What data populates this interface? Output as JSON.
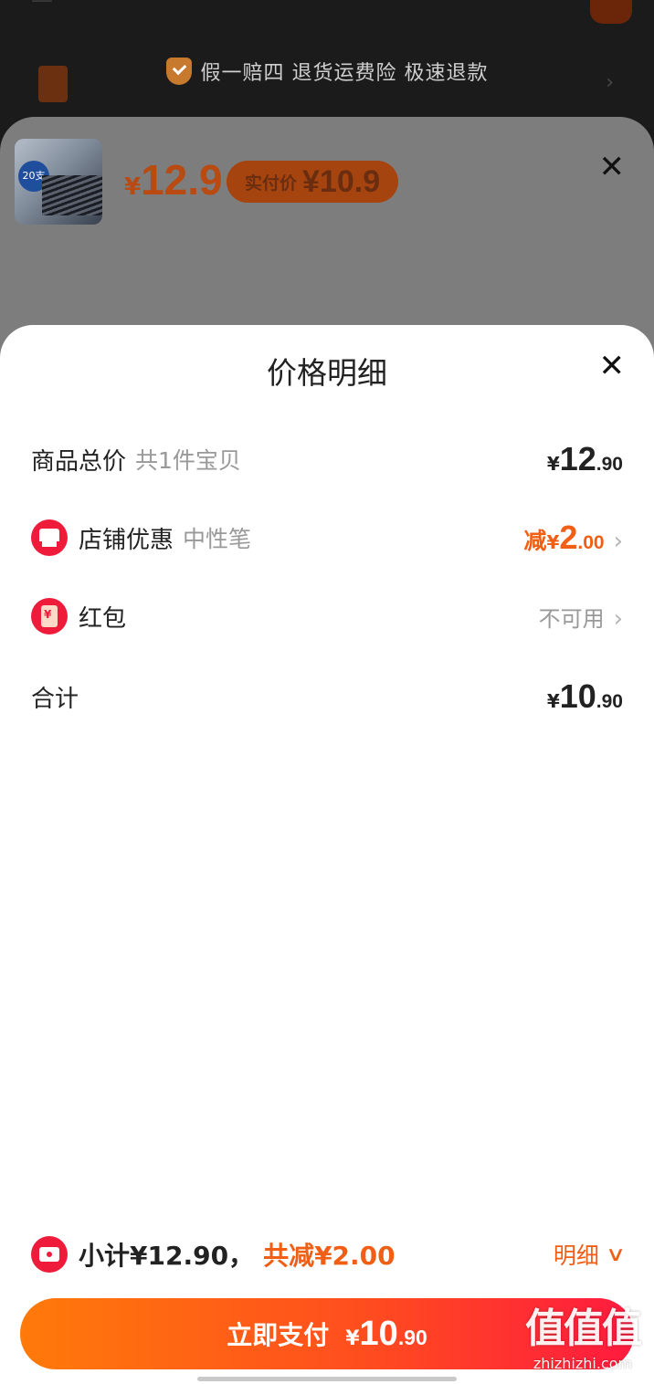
{
  "background": {
    "guarantee_text": "假一赔四  退货运费险  极速退款"
  },
  "product": {
    "thumb_label": "20支",
    "price_symbol": "¥",
    "price": "12.9",
    "paid_label": "实付价",
    "paid_price": "¥10.9"
  },
  "detail": {
    "title": "价格明细",
    "rows": {
      "goods_total": {
        "label": "商品总价",
        "sub": "共1件宝贝",
        "yen": "¥",
        "int": "12",
        "dec": ".90"
      },
      "shop_discount": {
        "label": "店铺优惠",
        "sub": "中性笔",
        "prefix": "减",
        "yen": "¥",
        "int": "2",
        "dec": ".00"
      },
      "red_packet": {
        "label": "红包",
        "value": "不可用"
      },
      "total": {
        "label": "合计",
        "yen": "¥",
        "int": "10",
        "dec": ".90"
      }
    }
  },
  "summary": {
    "subtotal": "小计¥12.90，",
    "saved": "共减¥2.00",
    "details_label": "明细"
  },
  "pay_button": {
    "label": "立即支付",
    "yen": "¥",
    "int": "10",
    "dec": ".90"
  },
  "watermark": {
    "main": "值值值",
    "sub": "zhizhizhi.com"
  },
  "colors": {
    "accent": "#f05f15",
    "icon_red": "#ee1b3b",
    "pay_gradient_start": "#ff7a0a",
    "pay_gradient_end": "#ff1a3f"
  }
}
